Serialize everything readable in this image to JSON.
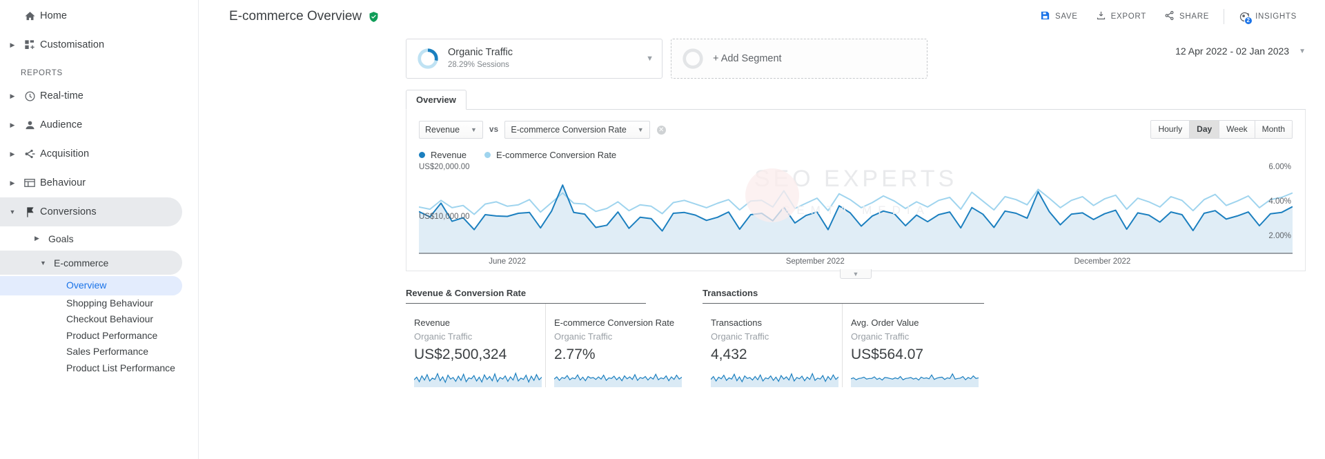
{
  "sidebar": {
    "top_items": [
      {
        "label": "Home",
        "icon": "home-icon",
        "caret": false
      },
      {
        "label": "Customisation",
        "icon": "customisation-icon",
        "caret": true
      }
    ],
    "section_label": "REPORTS",
    "report_items": [
      {
        "label": "Real-time",
        "icon": "clock-icon",
        "caret": true,
        "active": false
      },
      {
        "label": "Audience",
        "icon": "person-icon",
        "caret": true,
        "active": false
      },
      {
        "label": "Acquisition",
        "icon": "acquisition-icon",
        "caret": true,
        "active": false
      },
      {
        "label": "Behaviour",
        "icon": "behaviour-icon",
        "caret": true,
        "active": false
      },
      {
        "label": "Conversions",
        "icon": "flag-icon",
        "caret": true,
        "active": true
      }
    ],
    "sub_items": [
      {
        "label": "Goals",
        "expanded": false,
        "selected": false
      },
      {
        "label": "E-commerce",
        "expanded": true,
        "selected": true
      }
    ],
    "leaf_items": [
      {
        "label": "Overview",
        "current": true
      },
      {
        "label": "Shopping Behaviour",
        "current": false
      },
      {
        "label": "Checkout Behaviour",
        "current": false
      },
      {
        "label": "Product Performance",
        "current": false
      },
      {
        "label": "Sales Performance",
        "current": false
      },
      {
        "label": "Product List Performance",
        "current": false
      }
    ]
  },
  "header": {
    "title": "E-commerce Overview",
    "verified_icon": "green-shield-check-icon",
    "actions": [
      {
        "label": "SAVE",
        "icon": "save-icon"
      },
      {
        "label": "EXPORT",
        "icon": "export-icon"
      },
      {
        "label": "SHARE",
        "icon": "share-icon"
      },
      {
        "label": "INSIGHTS",
        "icon": "insights-icon",
        "badge": "2"
      }
    ]
  },
  "segments": {
    "applied": {
      "name": "Organic Traffic",
      "sublabel": "28.29% Sessions",
      "donut_percent": 28.29
    },
    "add_label": "+ Add Segment"
  },
  "date_range": {
    "value": "12 Apr 2022 -  02 Jan 2023"
  },
  "tabs": [
    {
      "label": "Overview",
      "active": true
    }
  ],
  "metric_selectors": {
    "primary": "Revenue",
    "vs_label": "vs",
    "secondary": "E-commerce Conversion Rate",
    "remove_icon": "close-circle-icon"
  },
  "granularity": {
    "options": [
      {
        "label": "Hourly",
        "selected": false
      },
      {
        "label": "Day",
        "selected": true
      },
      {
        "label": "Week",
        "selected": false
      },
      {
        "label": "Month",
        "selected": false
      }
    ]
  },
  "watermark": {
    "line1": "SEO EXPERTS",
    "line2": "GEMTA MEDIA"
  },
  "collapse_control": {
    "icon": "chevron-down-icon"
  },
  "chart_data": {
    "type": "line",
    "title": "",
    "xlabel": "",
    "ylabel": "",
    "grid": false,
    "legend_position": "top-left",
    "legend": [
      {
        "name": "Revenue",
        "color": "#1b7fbf"
      },
      {
        "name": "E-commerce Conversion Rate",
        "color": "#9fd4ee"
      }
    ],
    "left_axis": {
      "labels": [
        "US$20,000.00",
        "US$10,000.00"
      ],
      "ylim": [
        0,
        20000
      ],
      "format": "US$"
    },
    "right_axis": {
      "labels": [
        "6.00%",
        "4.00%",
        "2.00%"
      ],
      "ylim": [
        0,
        6
      ],
      "format": "%"
    },
    "xticks": [
      "June  2022",
      "September 2022",
      "December 2022"
    ],
    "xtick_positions_pct": [
      8,
      42,
      75
    ],
    "series": [
      {
        "name": "Revenue",
        "color": "#1b7fbf",
        "axis": "left",
        "values": [
          9300,
          8100,
          11200,
          7100,
          7900,
          5200,
          8600,
          8300,
          8200,
          8900,
          9100,
          5600,
          9400,
          15300,
          9100,
          8700,
          5700,
          6200,
          9200,
          5500,
          8000,
          7700,
          4900,
          8900,
          9100,
          8500,
          7300,
          8000,
          9200,
          5300,
          8600,
          8900,
          7200,
          10300,
          6700,
          8400,
          9200,
          5200,
          10600,
          9000,
          6000,
          8300,
          9400,
          8800,
          6100,
          8500,
          7000,
          8600,
          9200,
          5600,
          10200,
          8700,
          5700,
          9400,
          8900,
          7800,
          13800,
          9300,
          6300,
          8700,
          9000,
          7500,
          8800,
          9600,
          5300,
          9000,
          8500,
          6900,
          9200,
          8600,
          5000,
          8900,
          9500,
          7600,
          8300,
          9200,
          6100,
          8800,
          9100,
          10400
        ]
      },
      {
        "name": "E-commerce Conversion Rate",
        "color": "#9fd4ee",
        "axis": "right",
        "values": [
          3.1,
          2.95,
          3.55,
          3.05,
          3.2,
          2.6,
          3.3,
          3.45,
          3.15,
          3.25,
          3.6,
          2.75,
          3.4,
          4.05,
          3.35,
          3.3,
          2.8,
          3.0,
          3.45,
          2.85,
          3.25,
          3.15,
          2.65,
          3.4,
          3.55,
          3.3,
          3.05,
          3.35,
          3.6,
          2.9,
          3.5,
          3.55,
          3.1,
          4.2,
          3.0,
          3.35,
          3.7,
          2.85,
          4.0,
          3.6,
          3.05,
          3.4,
          3.85,
          3.5,
          3.0,
          3.45,
          3.1,
          3.55,
          3.75,
          2.95,
          4.1,
          3.5,
          2.9,
          3.8,
          3.6,
          3.25,
          4.3,
          3.7,
          3.05,
          3.55,
          3.8,
          3.2,
          3.65,
          3.9,
          2.95,
          3.7,
          3.45,
          3.1,
          3.8,
          3.55,
          2.85,
          3.6,
          3.95,
          3.2,
          3.5,
          3.85,
          3.05,
          3.6,
          3.75,
          4.05
        ]
      }
    ]
  },
  "bottom": {
    "groups": [
      {
        "title": "Revenue & Conversion Rate",
        "cards": [
          {
            "title": "Revenue",
            "segment": "Organic Traffic",
            "value": "US$2,500,324"
          },
          {
            "title": "E-commerce Conversion Rate",
            "segment": "Organic Traffic",
            "value": "2.77%"
          }
        ]
      },
      {
        "title": "Transactions",
        "cards": [
          {
            "title": "Transactions",
            "segment": "Organic Traffic",
            "value": "4,432"
          },
          {
            "title": "Avg. Order Value",
            "segment": "Organic Traffic",
            "value": "US$564.07"
          }
        ]
      }
    ],
    "sparklines": [
      [
        0.42,
        0.58,
        0.3,
        0.66,
        0.4,
        0.74,
        0.34,
        0.52,
        0.44,
        0.8,
        0.36,
        0.6,
        0.26,
        0.7,
        0.46,
        0.56,
        0.32,
        0.64,
        0.38,
        0.76,
        0.3,
        0.54,
        0.48,
        0.68,
        0.34,
        0.58,
        0.28,
        0.72,
        0.44,
        0.62,
        0.36,
        0.78,
        0.3,
        0.56,
        0.46,
        0.66,
        0.32,
        0.6,
        0.4,
        0.82,
        0.34,
        0.52,
        0.44,
        0.7,
        0.28,
        0.64,
        0.38,
        0.74,
        0.42,
        0.58
      ],
      [
        0.46,
        0.6,
        0.38,
        0.56,
        0.5,
        0.68,
        0.42,
        0.54,
        0.48,
        0.72,
        0.4,
        0.58,
        0.36,
        0.62,
        0.52,
        0.56,
        0.44,
        0.6,
        0.46,
        0.7,
        0.38,
        0.54,
        0.5,
        0.64,
        0.42,
        0.58,
        0.36,
        0.66,
        0.48,
        0.6,
        0.44,
        0.74,
        0.38,
        0.56,
        0.5,
        0.62,
        0.4,
        0.58,
        0.46,
        0.76,
        0.42,
        0.54,
        0.48,
        0.66,
        0.36,
        0.6,
        0.44,
        0.7,
        0.46,
        0.58
      ],
      [
        0.44,
        0.62,
        0.34,
        0.58,
        0.48,
        0.7,
        0.38,
        0.54,
        0.46,
        0.76,
        0.36,
        0.6,
        0.3,
        0.66,
        0.5,
        0.56,
        0.4,
        0.62,
        0.42,
        0.72,
        0.34,
        0.54,
        0.48,
        0.66,
        0.38,
        0.58,
        0.32,
        0.68,
        0.46,
        0.6,
        0.4,
        0.78,
        0.34,
        0.56,
        0.48,
        0.64,
        0.36,
        0.58,
        0.44,
        0.8,
        0.38,
        0.52,
        0.46,
        0.68,
        0.32,
        0.62,
        0.42,
        0.72,
        0.44,
        0.6
      ],
      [
        0.48,
        0.54,
        0.42,
        0.5,
        0.52,
        0.58,
        0.46,
        0.5,
        0.5,
        0.6,
        0.44,
        0.52,
        0.4,
        0.56,
        0.54,
        0.5,
        0.46,
        0.54,
        0.48,
        0.62,
        0.42,
        0.5,
        0.52,
        0.56,
        0.46,
        0.52,
        0.4,
        0.58,
        0.5,
        0.54,
        0.48,
        0.72,
        0.44,
        0.52,
        0.56,
        0.58,
        0.44,
        0.54,
        0.5,
        0.78,
        0.46,
        0.5,
        0.52,
        0.62,
        0.42,
        0.56,
        0.48,
        0.66,
        0.5,
        0.54
      ]
    ]
  },
  "colors": {
    "accent": "#1a73e8",
    "revenue_line": "#1b7fbf",
    "conversion_line": "#9fd4ee",
    "chart_fill": "#dbeaf5",
    "verified_green": "#0f9d58"
  }
}
